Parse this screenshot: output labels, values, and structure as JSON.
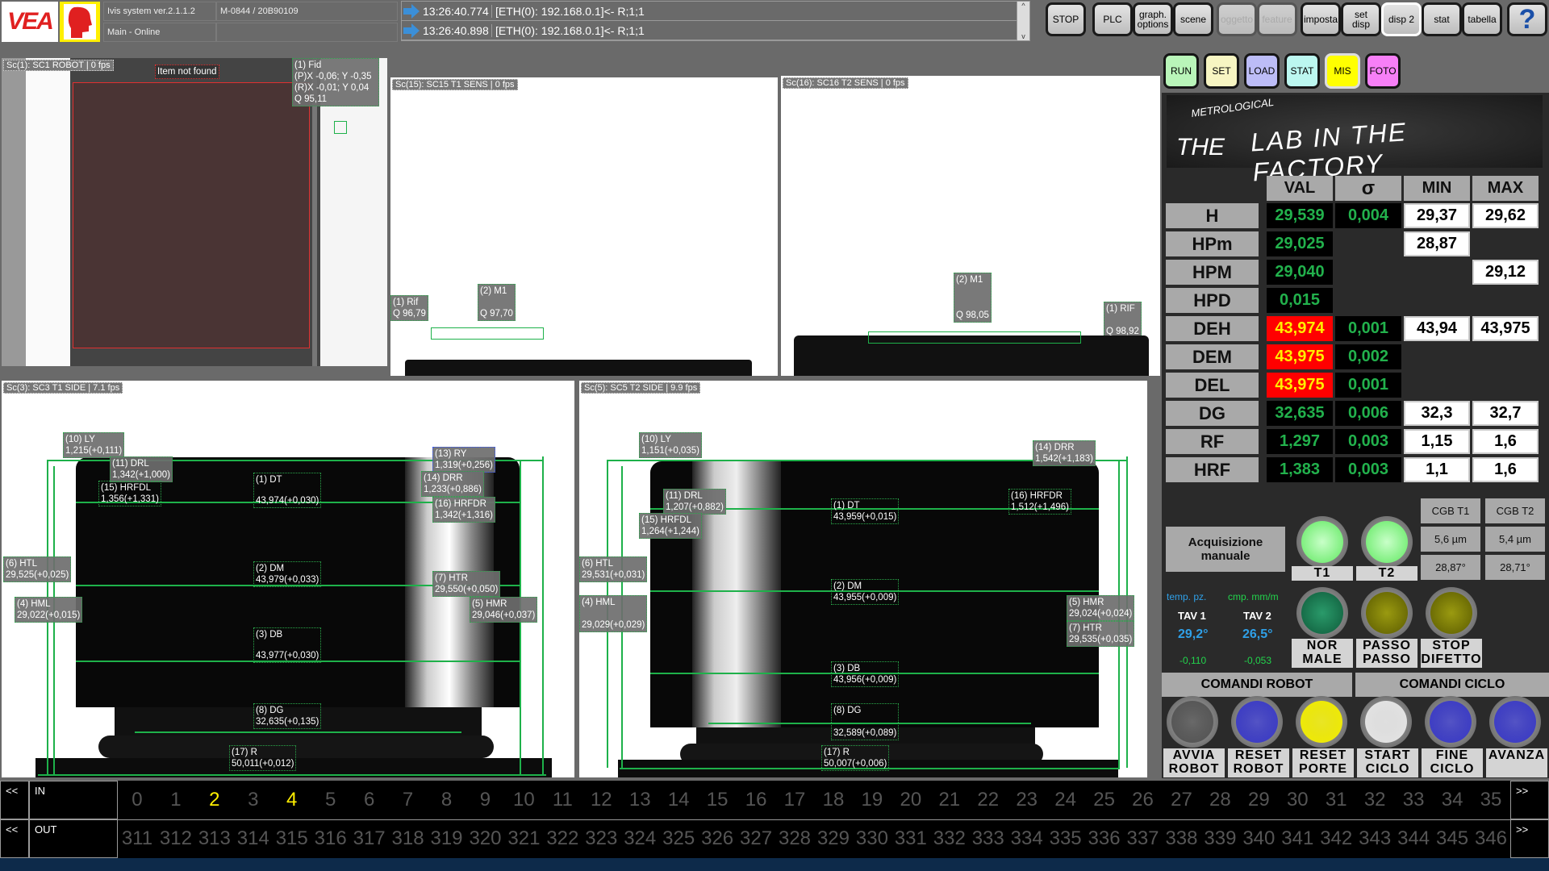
{
  "header": {
    "logo_text": "VEA",
    "version": "Ivis system ver.2.1.1.2",
    "status": "Main - Online",
    "machine_id": "M-0844 / 20B90109",
    "log": [
      {
        "time": "13:26:40.774",
        "message": "[ETH(0): 192.168.0.1]<- R;1;1"
      },
      {
        "time": "13:26:40.898",
        "message": "[ETH(0): 192.168.0.1]<- R;1;1"
      }
    ]
  },
  "toolbar": {
    "stop": "STOP",
    "plc": "PLC",
    "graph1": "graph.",
    "graph2": "options",
    "scene": "scene",
    "oggetto": "oggetto",
    "feature": "feature",
    "imposta": "imposta",
    "setdisp1": "set",
    "setdisp2": "disp",
    "disp2": "disp 2",
    "stat": "stat",
    "tabella": "tabella",
    "help": "?"
  },
  "modes": {
    "run": "RUN",
    "set": "SET",
    "load": "LOAD",
    "stat": "STAT",
    "mis": "MIS",
    "foto": "FOTO",
    "colors": {
      "run": "#b9f5b9",
      "set": "#f7f5c2",
      "load": "#bcbcf7",
      "stat": "#bcf7f0",
      "mis": "#ffff00",
      "foto": "#f77ff7"
    }
  },
  "banner": {
    "small": "METROLOGICAL",
    "the": "THE",
    "main": "LAB IN THE FACTORY"
  },
  "cameras": {
    "sc1": {
      "label": "Sc(1): SC1 ROBOT | 0 fps",
      "status": "Item not found",
      "fid": [
        "(1) Fid",
        "(P)X -0,06; Y -0,35",
        "(R)X -0,01; Y 0,04",
        "Q 95,11"
      ]
    },
    "sc15": {
      "label": "Sc(15): SC15 T1 SENS | 0 fps",
      "rif": [
        "(1) Rif",
        "Q 96,79"
      ],
      "m1": [
        "(2) M1",
        "Q 97,70"
      ]
    },
    "sc16": {
      "label": "Sc(16): SC16 T2 SENS | 0 fps",
      "m1": [
        "(2) M1",
        "Q 98,05"
      ],
      "rif": [
        "(1) RIF",
        "Q 98,92"
      ]
    },
    "sc3": {
      "label": "Sc(3): SC3 T1 SIDE | 7.1 fps",
      "tags": {
        "ly": [
          "(10) LY",
          "1,215(+0,111)"
        ],
        "drl": [
          "(11) DRL",
          "1,342(+1,000)"
        ],
        "hrfdl": [
          "(15) HRFDL",
          "1,356(+1,331)"
        ],
        "dt": [
          "(1) DT",
          "43,974(+0,030)"
        ],
        "ry": [
          "(13) RY",
          "1,319(+0,256)"
        ],
        "drr": [
          "(14) DRR",
          "1,233(+0,886)"
        ],
        "hrfdr": [
          "(16) HRFDR",
          "1,342(+1,316)"
        ],
        "htl": [
          "(6) HTL",
          "29,525(+0,025)"
        ],
        "dm": [
          "(2) DM",
          "43,979(+0,033)"
        ],
        "htr": [
          "(7) HTR",
          "29,550(+0,050)"
        ],
        "hml": [
          "(4) HML",
          "29,022(+0,015)"
        ],
        "hmr": [
          "(5) HMR",
          "29,046(+0,037)"
        ],
        "db": [
          "(3) DB",
          "43,977(+0,030)"
        ],
        "dg": [
          "(8) DG",
          "32,635(+0,135)"
        ],
        "r": [
          "(17) R",
          "50,011(+0,012)"
        ]
      }
    },
    "sc5": {
      "label": "Sc(5): SC5 T2 SIDE | 9.9 fps",
      "tags": {
        "ly": [
          "(10) LY",
          "1,151(+0,035)"
        ],
        "drl": [
          "(11) DRL",
          "1,207(+0,882)"
        ],
        "hrfdl": [
          "(15) HRFDL",
          "1,264(+1,244)"
        ],
        "dt": [
          "(1) DT",
          "43,959(+0,015)"
        ],
        "drr": [
          "(14) DRR",
          "1,542(+1,183)"
        ],
        "hrfdr": [
          "(16) HRFDR",
          "1,512(+1,496)"
        ],
        "htl": [
          "(6) HTL",
          "29,531(+0,031)"
        ],
        "dm": [
          "(2) DM",
          "43,955(+0,009)"
        ],
        "hml": [
          "(4) HML",
          "29,029(+0,029)"
        ],
        "hmr": [
          "(5) HMR",
          "29,024(+0,024)"
        ],
        "htr": [
          "(7) HTR",
          "29,535(+0,035)"
        ],
        "db": [
          "(3) DB",
          "43,956(+0,009)"
        ],
        "dg": [
          "(8) DG",
          "32,589(+0,089)"
        ],
        "r": [
          "(17) R",
          "50,007(+0,006)"
        ]
      }
    }
  },
  "table": {
    "headers": [
      "VAL",
      "σ",
      "MIN",
      "MAX"
    ],
    "rows": [
      {
        "name": "H",
        "val": "29,539",
        "sigma": "0,004",
        "min": "29,37",
        "max": "29,62",
        "alarm": false
      },
      {
        "name": "HPm",
        "val": "29,025",
        "sigma": "",
        "min": "28,87",
        "max": "",
        "alarm": false
      },
      {
        "name": "HPM",
        "val": "29,040",
        "sigma": "",
        "min": "",
        "max": "29,12",
        "alarm": false
      },
      {
        "name": "HPD",
        "val": "0,015",
        "sigma": "",
        "min": "",
        "max": "",
        "alarm": false
      },
      {
        "name": "DEH",
        "val": "43,974",
        "sigma": "0,001",
        "min": "43,94",
        "max": "43,975",
        "alarm": true
      },
      {
        "name": "DEM",
        "val": "43,975",
        "sigma": "0,002",
        "min": "",
        "max": "",
        "alarm": true
      },
      {
        "name": "DEL",
        "val": "43,975",
        "sigma": "0,001",
        "min": "",
        "max": "",
        "alarm": true
      },
      {
        "name": "DG",
        "val": "32,635",
        "sigma": "0,006",
        "min": "32,3",
        "max": "32,7",
        "alarm": false
      },
      {
        "name": "RF",
        "val": "1,297",
        "sigma": "0,003",
        "min": "1,15",
        "max": "1,6",
        "alarm": false
      },
      {
        "name": "HRF",
        "val": "1,383",
        "sigma": "0,003",
        "min": "1,1",
        "max": "1,6",
        "alarm": false
      }
    ]
  },
  "controls": {
    "acq1": "Acquisizione",
    "acq2": "manuale",
    "t1": "T1",
    "t2": "T2",
    "cgb_t1": "CGB T1",
    "cgb_t2": "CGB T2",
    "cgb_t1_um": "5,6 µm",
    "cgb_t2_um": "5,4 µm",
    "cgb_t1_deg": "28,87°",
    "cgb_t2_deg": "28,71°",
    "temp_label": "temp. pz.",
    "cmp_label": "cmp. mm/m",
    "tav1": "TAV 1",
    "tav2": "TAV 2",
    "tav1_temp": "29,2°",
    "tav2_temp": "26,5°",
    "tav1_cmp": "-0,110",
    "tav2_cmp": "-0,053",
    "normale1": "NOR",
    "normale2": "MALE",
    "passo1": "PASSO",
    "passo2": "PASSO",
    "stop1": "STOP",
    "stop2": "DIFETTO",
    "comandi_robot": "COMANDI ROBOT",
    "comandi_ciclo": "COMANDI CICLO",
    "cmd": [
      {
        "l1": "AVVIA",
        "l2": "ROBOT",
        "color": "#555555"
      },
      {
        "l1": "RESET",
        "l2": "ROBOT",
        "color": "#3a3ac8"
      },
      {
        "l1": "RESET",
        "l2": "PORTE",
        "color": "#f5f000"
      },
      {
        "l1": "START",
        "l2": "CICLO",
        "color": "#e8e8e8"
      },
      {
        "l1": "FINE",
        "l2": "CICLO",
        "color": "#3a3ac8"
      },
      {
        "l1": "AVANZA",
        "l2": "",
        "color": "#3a3ac8"
      }
    ]
  },
  "io": {
    "prev": "<<",
    "next": ">>",
    "in_label": "IN",
    "out_label": "OUT",
    "in": [
      "0",
      "1",
      "2",
      "3",
      "4",
      "5",
      "6",
      "7",
      "8",
      "9",
      "10",
      "11",
      "12",
      "13",
      "14",
      "15",
      "16",
      "17",
      "18",
      "19",
      "20",
      "21",
      "22",
      "23",
      "24",
      "25",
      "26",
      "27",
      "28",
      "29",
      "30",
      "31",
      "32",
      "33",
      "34",
      "35"
    ],
    "in_active": [
      2,
      4
    ],
    "out": [
      "311",
      "312",
      "313",
      "314",
      "315",
      "316",
      "317",
      "318",
      "319",
      "320",
      "321",
      "322",
      "323",
      "324",
      "325",
      "326",
      "327",
      "328",
      "329",
      "330",
      "331",
      "332",
      "333",
      "334",
      "335",
      "336",
      "337",
      "338",
      "339",
      "340",
      "341",
      "342",
      "343",
      "344",
      "345",
      "346"
    ]
  }
}
